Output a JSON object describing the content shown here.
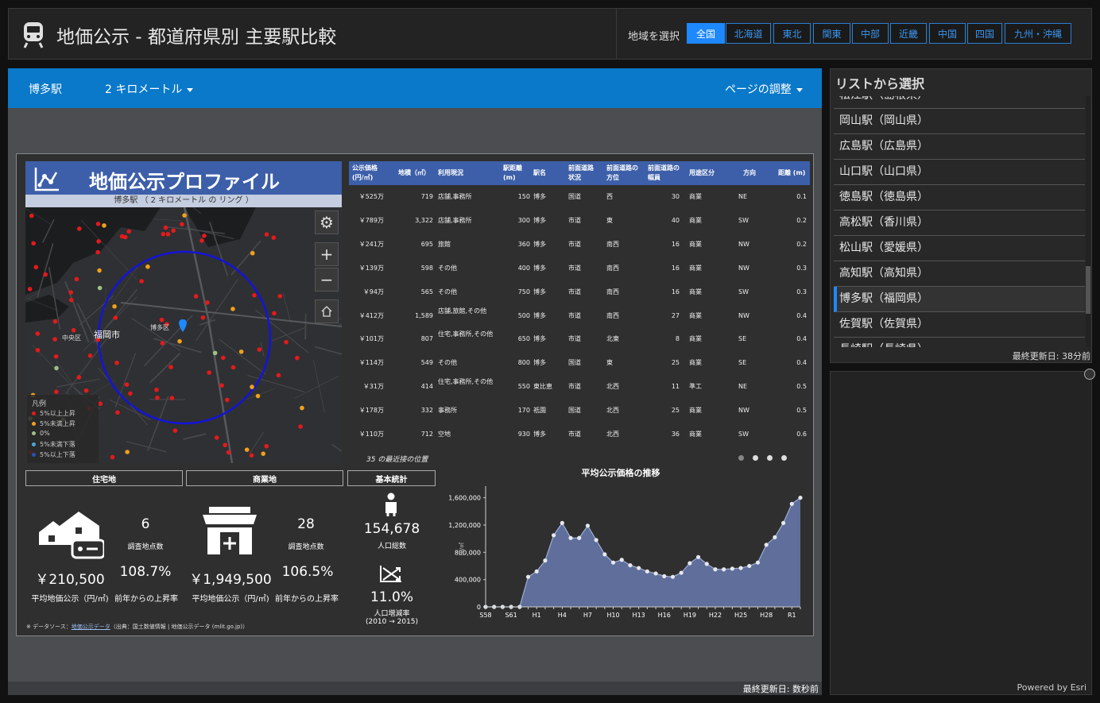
{
  "header": {
    "title": "地価公示 - 都道府県別 主要駅比較",
    "region_label": "地域を選択",
    "regions": [
      "全国",
      "北海道",
      "東北",
      "関東",
      "中部",
      "近畿",
      "中国",
      "四国",
      "九州・沖縄"
    ],
    "active_region": "全国"
  },
  "toolbar": {
    "station": "博多駅",
    "distance": "2 キロメートル",
    "page_adjust": "ページの調整"
  },
  "profile": {
    "title": "地価公示プロファイル",
    "subtitle": "博多駅 （ 2 キロメートル の リング ）",
    "map_labels": [
      "福岡市",
      "中央区",
      "博多区"
    ],
    "legend": {
      "title": "凡例",
      "items": [
        "5%以上上昇",
        "5%未満上昇",
        "0%",
        "5%未満下落",
        "5%以上下落"
      ],
      "colors": [
        "#e31a1c",
        "#f0a01c",
        "#9fbf88",
        "#4ea6d8",
        "#2a4fb8"
      ]
    }
  },
  "table": {
    "headers": [
      "公示価格\n(円/㎡)",
      "地積（㎡）",
      "利用現況",
      "駅距離\n(m)",
      "駅名",
      "前面道路\n状況",
      "前面道路の\n方位",
      "前面道路の\n幅員",
      "用途区分",
      "方向",
      "距離 (m)"
    ],
    "rows": [
      [
        "￥525万",
        "719",
        "店舗,事務所",
        "150",
        "博多",
        "国道",
        "西",
        "30",
        "商業",
        "NE",
        "0.1"
      ],
      [
        "￥789万",
        "3,322",
        "店舗,事務所",
        "300",
        "博多",
        "市道",
        "東",
        "40",
        "商業",
        "SW",
        "0.2"
      ],
      [
        "￥241万",
        "695",
        "旅館",
        "360",
        "博多",
        "市道",
        "南西",
        "16",
        "商業",
        "NW",
        "0.2"
      ],
      [
        "￥139万",
        "598",
        "その他",
        "400",
        "博多",
        "市道",
        "南西",
        "16",
        "商業",
        "NW",
        "0.3"
      ],
      [
        "￥94万",
        "565",
        "その他",
        "750",
        "博多",
        "市道",
        "南西",
        "16",
        "商業",
        "SW",
        "0.3"
      ],
      [
        "￥412万",
        "1,589",
        "店舗,旅館,その他",
        "500",
        "博多",
        "市道",
        "南西",
        "27",
        "商業",
        "NW",
        "0.4"
      ],
      [
        "￥101万",
        "807",
        "住宅,事務所,その他",
        "650",
        "博多",
        "市道",
        "北東",
        "8",
        "商業",
        "SE",
        "0.4"
      ],
      [
        "￥114万",
        "549",
        "その他",
        "800",
        "博多",
        "国道",
        "東",
        "25",
        "商業",
        "SE",
        "0.4"
      ],
      [
        "￥31万",
        "414",
        "住宅,事務所,その他",
        "550",
        "東比恵",
        "市道",
        "北西",
        "11",
        "準工",
        "NE",
        "0.5"
      ],
      [
        "￥178万",
        "332",
        "事務所",
        "170",
        "祇園",
        "国道",
        "北西",
        "25",
        "商業",
        "NW",
        "0.5"
      ],
      [
        "￥110万",
        "712",
        "空地",
        "930",
        "博多",
        "市道",
        "北西",
        "36",
        "商業",
        "SW",
        "0.6"
      ]
    ],
    "nearest_text": "35 の最近接の位置"
  },
  "sections": {
    "residential": "住宅地",
    "commercial": "商業地",
    "basic": "基本統計"
  },
  "residential": {
    "count": "6",
    "count_label": "調査地点数",
    "avg_price": "￥210,500",
    "avg_price_label": "平均地価公示（円/㎡)",
    "rate": "108.7%",
    "rate_label": "前年からの上昇率"
  },
  "commercial": {
    "count": "28",
    "count_label": "調査地点数",
    "avg_price": "￥1,949,500",
    "avg_price_label": "平均地価公示（円/㎡)",
    "rate": "106.5%",
    "rate_label": "前年からの上昇率"
  },
  "basic": {
    "population": "154,678",
    "population_label": "人口総数",
    "growth": "11.0%",
    "growth_label": "人口増減率",
    "growth_period": "(2010 → 2015)"
  },
  "datasource": {
    "prefix": "※ データソース：",
    "link": "地価公示データ",
    "source": "（出典：国土数値情報 | 地価公示データ (mlit.go.jp)）"
  },
  "chart_data": {
    "type": "area",
    "title": "平均公示価格の推移",
    "ylabel": "円/㎡",
    "ylim": [
      0,
      1700000
    ],
    "yticks": [
      "0",
      "400,000",
      "800,000",
      "1,200,000",
      "1,600,000"
    ],
    "xtick_labels": [
      "S58",
      "S61",
      "H1",
      "H4",
      "H7",
      "H10",
      "H13",
      "H16",
      "H19",
      "H22",
      "H25",
      "H28",
      "R1"
    ],
    "values": [
      0,
      0,
      0,
      0,
      0,
      440000,
      520000,
      680000,
      1050000,
      1230000,
      1010000,
      1010000,
      1190000,
      980000,
      770000,
      650000,
      690000,
      610000,
      570000,
      520000,
      490000,
      450000,
      440000,
      500000,
      640000,
      730000,
      630000,
      550000,
      550000,
      560000,
      570000,
      600000,
      650000,
      910000,
      1020000,
      1230000,
      1510000,
      1600000
    ],
    "area_color": "#5f6e9a",
    "line_color": "#9fb0d8"
  },
  "list": {
    "title": "リストから選択",
    "items": [
      "松江駅（島根県）",
      "岡山駅（岡山県）",
      "広島駅（広島県）",
      "山口駅（山口県）",
      "徳島駅（徳島県）",
      "高松駅（香川県）",
      "松山駅（愛媛県）",
      "高知駅（高知県）",
      "博多駅（福岡県）",
      "佐賀駅（佐賀県）",
      "長崎駅（長崎県）"
    ],
    "selected": "博多駅（福岡県）",
    "updated": "最終更新日: 38分前"
  },
  "main_updated": "最終更新日: 数秒前",
  "powered": "Powered by Esri",
  "colors": {
    "accent": "#1e88ff",
    "toolbar": "#0a79c9",
    "profile_blue": "#3d5fa9"
  }
}
